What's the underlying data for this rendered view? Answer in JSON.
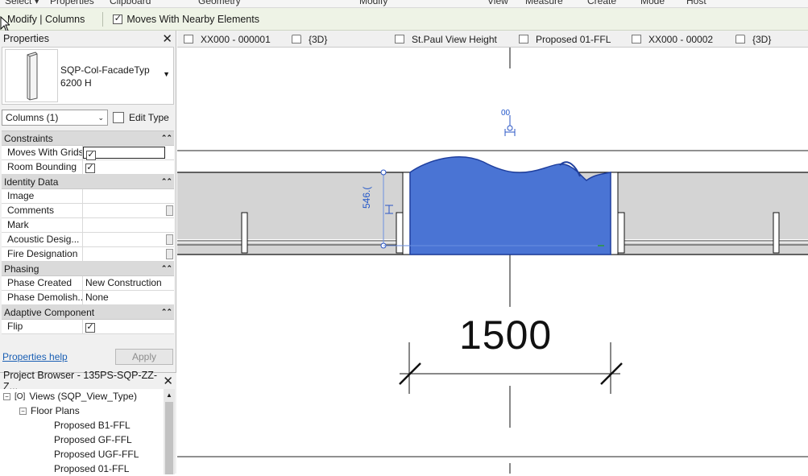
{
  "ribbon_top": [
    "Select ▾",
    "Properties",
    "Clipboard",
    "Geometry",
    "Modify",
    "View",
    "Measure",
    "Create",
    "Mode",
    "Host"
  ],
  "options_bar": {
    "context": "Modify | Columns",
    "moves_with_nearby": "Moves With Nearby Elements",
    "moves_with_nearby_checked": "✓"
  },
  "properties": {
    "title": "Properties",
    "type_name_line1": "SQP-Col-FacadeTyp",
    "type_name_line2": "6200 H",
    "instance_filter": "Columns (1)",
    "edit_type": "Edit Type",
    "categories": {
      "constraints": "Constraints",
      "identity": "Identity Data",
      "phasing": "Phasing",
      "adaptive": "Adaptive Component"
    },
    "rows": {
      "moves_with_grids": "Moves With Grids",
      "room_bounding": "Room Bounding",
      "image": "Image",
      "comments": "Comments",
      "mark": "Mark",
      "acoustic": "Acoustic Desig...",
      "fire": "Fire Designation",
      "phase_created": "Phase Created",
      "phase_created_val": "New Construction",
      "phase_demolished": "Phase Demolish...",
      "phase_demolished_val": "None",
      "flip": "Flip"
    },
    "check": "✓",
    "help_link": "Properties help",
    "apply": "Apply"
  },
  "project_browser": {
    "title": "Project Browser - 135PS-SQP-ZZ-Z...",
    "items": [
      "Views (SQP_View_Type)",
      "Floor Plans",
      "Proposed B1-FFL",
      "Proposed GF-FFL",
      "Proposed UGF-FFL",
      "Proposed 01-FFL"
    ]
  },
  "view_tabs": [
    "XX000 - 000001",
    "{3D}",
    "St.Paul View Height",
    "Proposed 01-FFL",
    "XX000 - 00002",
    "{3D}"
  ],
  "canvas": {
    "main_dimension": "1500",
    "small_dimension": "00",
    "temp_dimension": "546.("
  },
  "colors": {
    "selection_blue": "#4a74d4",
    "options_bar_bg": "#eef3e6",
    "wall_grey": "#d4d4d4",
    "link_blue": "#1a5fb4"
  }
}
